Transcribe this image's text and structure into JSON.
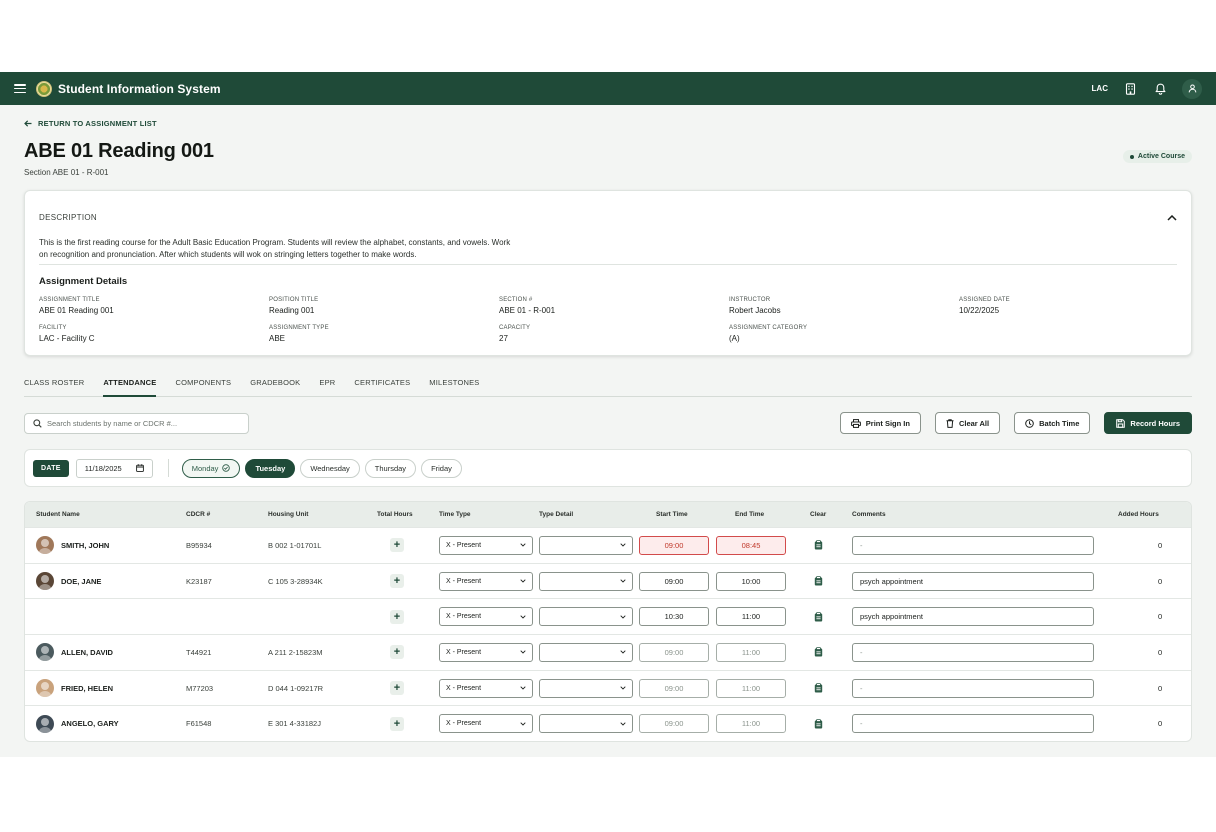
{
  "app": {
    "title": "Student Information System",
    "location_code": "LAC"
  },
  "nav": {
    "back_label": "RETURN TO ASSIGNMENT LIST"
  },
  "page": {
    "title": "ABE 01 Reading 001",
    "subtitle": "Section ABE 01 - R-001",
    "status": "Active Course"
  },
  "description": {
    "label": "DESCRIPTION",
    "text": "This is the first reading course for the Adult Basic Education Program. Students will review the alphabet, constants, and vowels. Work on recognition and pronunciation. After which students will wok on stringing letters together to make words."
  },
  "details": {
    "title": "Assignment Details",
    "fields": [
      {
        "label": "ASSIGNMENT TITLE",
        "value": "ABE 01 Reading 001"
      },
      {
        "label": "POSITION TITLE",
        "value": "Reading 001"
      },
      {
        "label": "SECTION #",
        "value": "ABE 01 - R-001"
      },
      {
        "label": "INSTRUCTOR",
        "value": "Robert Jacobs"
      },
      {
        "label": "ASSIGNED DATE",
        "value": "10/22/2025"
      },
      {
        "label": "FACILITY",
        "value": "LAC - Facility C"
      },
      {
        "label": "ASSIGNMENT TYPE",
        "value": "ABE"
      },
      {
        "label": "CAPACITY",
        "value": "27"
      },
      {
        "label": "ASSIGNMENT CATEGORY",
        "value": "(A)"
      }
    ]
  },
  "tabs": [
    "CLASS ROSTER",
    "ATTENDANCE",
    "COMPONENTS",
    "GRADEBOOK",
    "EPR",
    "CERTIFICATES",
    "MILESTONES"
  ],
  "toolbar": {
    "search_placeholder": "Search students by name or CDCR #...",
    "print_label": "Print Sign In",
    "clear_label": "Clear All",
    "batch_label": "Batch Time",
    "record_label": "Record Hours"
  },
  "datebar": {
    "chip": "DATE",
    "date": "11/18/2025",
    "days": [
      "Monday",
      "Tuesday",
      "Wednesday",
      "Thursday",
      "Friday"
    ]
  },
  "table": {
    "headers": {
      "name": "Student Name",
      "cdcr": "CDCR #",
      "housing": "Housing Unit",
      "total": "Total Hours",
      "time_type": "Time Type",
      "type_detail": "Type Detail",
      "start": "Start Time",
      "end": "End Time",
      "clear": "Clear",
      "comments": "Comments",
      "added": "Added Hours"
    },
    "rows": [
      {
        "name": "SMITH, JOHN",
        "cdcr": "B95934",
        "housing": "B 002 1-01701L",
        "time_type": "X - Present",
        "type_detail": "",
        "start": "09:00",
        "end": "08:45",
        "comment": "-",
        "added": "0"
      },
      {
        "name": "DOE, JANE",
        "cdcr": "K23187",
        "housing": "C 105 3-28934K",
        "time_type": "X - Present",
        "type_detail": "",
        "start": "09:00",
        "end": "10:00",
        "comment": "psych appointment",
        "added": "0"
      },
      {
        "name": "",
        "cdcr": "",
        "housing": "",
        "time_type": "X - Present",
        "type_detail": "",
        "start": "10:30",
        "end": "11:00",
        "comment": "psych appointment",
        "added": "0"
      },
      {
        "name": "ALLEN, DAVID",
        "cdcr": "T44921",
        "housing": "A 211 2-15823M",
        "time_type": "X - Present",
        "type_detail": "",
        "start": "09:00",
        "end": "11:00",
        "comment": "-",
        "added": "0"
      },
      {
        "name": "FRIED, HELEN",
        "cdcr": "M77203",
        "housing": "D 044 1-09217R",
        "time_type": "X - Present",
        "type_detail": "",
        "start": "09:00",
        "end": "11:00",
        "comment": "-",
        "added": "0"
      },
      {
        "name": "ANGELO, GARY",
        "cdcr": "F61548",
        "housing": "E 301 4-33182J",
        "time_type": "X - Present",
        "type_detail": "",
        "start": "09:00",
        "end": "11:00",
        "comment": "-",
        "added": "0"
      }
    ]
  },
  "colors": {
    "brand": "#1f4a38",
    "error": "#d24b4b",
    "background": "#f3f5f3"
  }
}
